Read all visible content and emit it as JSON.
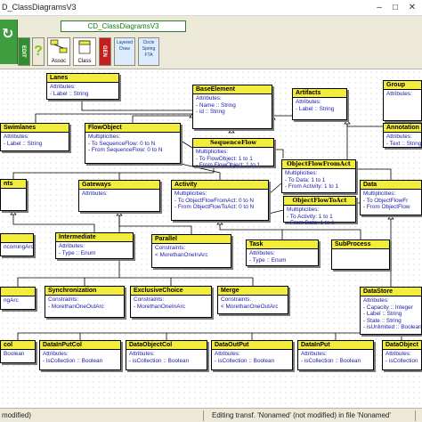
{
  "window": {
    "title": "D_ClassDiagramsV3"
  },
  "toolbar": {
    "tab_label": "CD_ClassDiagramsV3",
    "buttons": {
      "edit": "EDIT",
      "help": "?",
      "assoc": "Assoc",
      "class": "Class",
      "gen": "GEN",
      "layered": "Layered Draw",
      "circle": "Circle Spring FTA"
    }
  },
  "classes": [
    {
      "id": "lanes",
      "title": "Lanes",
      "sections": [
        {
          "kind": "Attributes:",
          "rows": [
            "- Label :: String"
          ]
        }
      ]
    },
    {
      "id": "baseelement",
      "title": "BaseElement",
      "sections": [
        {
          "kind": "Attributes:",
          "rows": [
            "- Name :: String",
            "- id :: String"
          ]
        }
      ]
    },
    {
      "id": "artifacts",
      "title": "Artifacts",
      "sections": [
        {
          "kind": "Attributes:",
          "rows": [
            "- Label :: String"
          ]
        }
      ]
    },
    {
      "id": "group",
      "title": "Group",
      "sections": [
        {
          "kind": "Attributes:",
          "rows": []
        }
      ]
    },
    {
      "id": "swimlanes",
      "title": "Swimlanes",
      "sections": [
        {
          "kind": "Attributes:",
          "rows": [
            "- Label :: String"
          ]
        }
      ]
    },
    {
      "id": "flowobject",
      "title": "FlowObject",
      "sections": [
        {
          "kind": "Multiplicities:",
          "rows": [
            "- To SequenceFlow: 0 to N",
            "- From SequenceFlow: 0 to N"
          ]
        }
      ]
    },
    {
      "id": "annotations",
      "title": "Annotation",
      "sections": [
        {
          "kind": "Attributes:",
          "rows": [
            "- Text :: String"
          ]
        }
      ]
    },
    {
      "id": "events",
      "title": "nts",
      "sections": [
        {
          "kind": "",
          "rows": []
        }
      ]
    },
    {
      "id": "gateways",
      "title": "Gateways",
      "sections": [
        {
          "kind": "Attributes:",
          "rows": []
        }
      ]
    },
    {
      "id": "activity",
      "title": "Activity",
      "sections": [
        {
          "kind": "Multiplicities:",
          "rows": [
            "- To ObjectFlowFromAct: 0 to N",
            "- From ObjectFlowToAct: 0 to N"
          ]
        }
      ]
    },
    {
      "id": "data",
      "title": "Data",
      "sections": [
        {
          "kind": "Multiplicities:",
          "rows": [
            "- To ObjectFlowFr",
            "- From ObjectFlow"
          ]
        }
      ]
    },
    {
      "id": "incomingarc",
      "title": "",
      "sections": [
        {
          "kind": "",
          "rows": [
            "ncomingArc"
          ]
        }
      ]
    },
    {
      "id": "intermediate",
      "title": "Intermediate",
      "sections": [
        {
          "kind": "Attributes:",
          "rows": [
            "- Type :: Enum"
          ]
        }
      ]
    },
    {
      "id": "parallel",
      "title": "Parallel",
      "sections": [
        {
          "kind": "Constraints:",
          "rows": [
            "< MorethanOneInArc"
          ]
        }
      ]
    },
    {
      "id": "task",
      "title": "Task",
      "sections": [
        {
          "kind": "Attributes:",
          "rows": [
            "- Type :: Enum"
          ]
        }
      ]
    },
    {
      "id": "subprocess",
      "title": "SubProcess",
      "sections": [
        {
          "kind": "",
          "rows": []
        }
      ]
    },
    {
      "id": "outarc",
      "title": "",
      "sections": [
        {
          "kind": "",
          "rows": [
            "ngArc"
          ]
        }
      ]
    },
    {
      "id": "synchronization",
      "title": "Synchronization",
      "sections": [
        {
          "kind": "Constraints:",
          "rows": [
            "- MorethanOneOutArc"
          ]
        }
      ]
    },
    {
      "id": "exclusivechoice",
      "title": "ExclusiveChoice",
      "sections": [
        {
          "kind": "Constraints:",
          "rows": [
            "- MorethanOneInArc"
          ]
        }
      ]
    },
    {
      "id": "merge",
      "title": "Merge",
      "sections": [
        {
          "kind": "Constraints:",
          "rows": [
            "< MorethanOneOutArc"
          ]
        }
      ]
    },
    {
      "id": "datastore",
      "title": "DataStore",
      "sections": [
        {
          "kind": "Attributes:",
          "rows": [
            "- Capacity :: Integer",
            "- Label :: String",
            "- State :: String",
            "- isUnlimited :: Boolean"
          ]
        }
      ]
    },
    {
      "id": "col",
      "title": "col",
      "sections": [
        {
          "kind": "",
          "rows": [
            "Boolean"
          ]
        }
      ]
    },
    {
      "id": "datainputcol",
      "title": "DataInPutCol",
      "sections": [
        {
          "kind": "Attributes:",
          "rows": [
            "- isCollection :: Boolean"
          ]
        }
      ]
    },
    {
      "id": "dataobjectcol",
      "title": "DataObjectCol",
      "sections": [
        {
          "kind": "Attributes:",
          "rows": [
            "- isCollection :: Boolean"
          ]
        }
      ]
    },
    {
      "id": "dataoutput",
      "title": "DataOutPut",
      "sections": [
        {
          "kind": "Attributes:",
          "rows": [
            "- isCollection :: Boolean"
          ]
        }
      ]
    },
    {
      "id": "datainput",
      "title": "DataInPut",
      "sections": [
        {
          "kind": "Attributes:",
          "rows": [
            "- isCollection :: Boolean"
          ]
        }
      ]
    },
    {
      "id": "dataobject",
      "title": "DataObject",
      "sections": [
        {
          "kind": "Attributes:",
          "rows": [
            "- isCollection"
          ]
        }
      ]
    }
  ],
  "associations": [
    {
      "id": "sequenceflow",
      "title": "SequenceFlow",
      "sections": [
        {
          "kind": "Multiplicities:",
          "rows": [
            "- To FlowObject: 1 to 1",
            "- From FlowObject: 1 to 1"
          ]
        }
      ]
    },
    {
      "id": "objectflowfromact",
      "title": "ObjectFlowFromAct",
      "sections": [
        {
          "kind": "Multiplicities:",
          "rows": [
            "- To Data: 1 to 1",
            "- From Activity: 1 to 1"
          ]
        }
      ]
    },
    {
      "id": "objectflowtoact",
      "title": "ObjectFlowToAct",
      "sections": [
        {
          "kind": "Multiplicities:",
          "rows": [
            "- To Activity: 1 to 1",
            "- From Data: 1 to 1"
          ]
        }
      ]
    }
  ],
  "statusbar": {
    "left": "modified)",
    "right": "Editing transf. 'Nonamed' (not modified) in file 'Nonamed'"
  },
  "colors": {
    "class_header": "#f2ec3a",
    "attribute_text": "#1a1aa8",
    "toolbar_bg": "#ece9d8"
  }
}
